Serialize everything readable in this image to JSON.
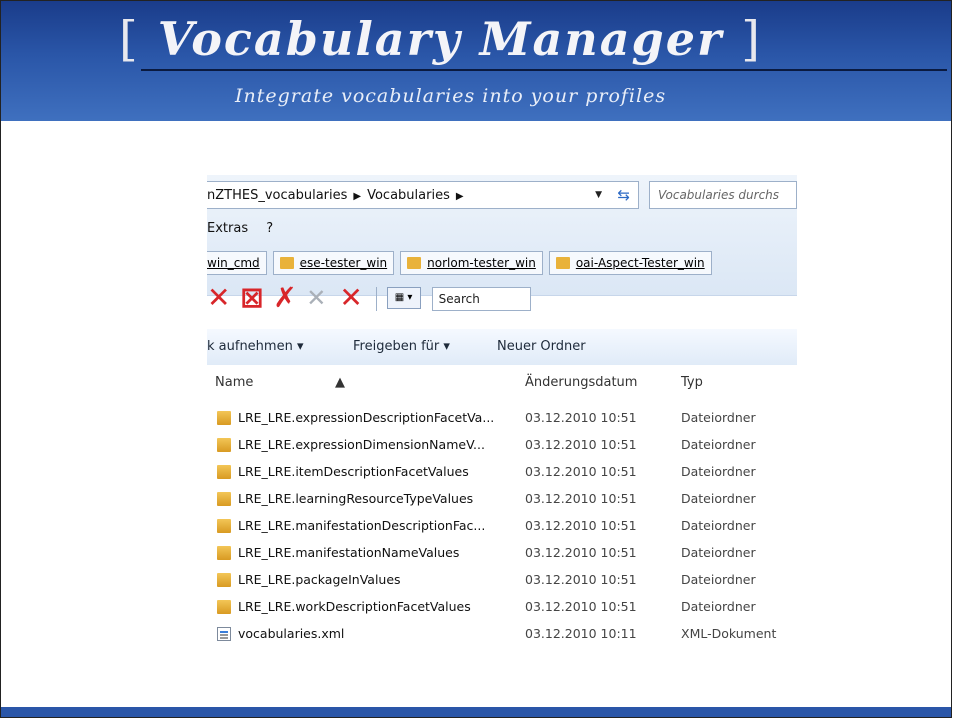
{
  "slide": {
    "title_open": "[",
    "title": "Vocabulary Manager",
    "title_close": "]",
    "subtitle": "Integrate vocabularies into your profiles"
  },
  "explorer": {
    "address": {
      "crumb1": "nZTHES_vocabularies",
      "crumb2": "Vocabularies"
    },
    "search_placeholder": "Vocabularies durchs",
    "menu": [
      "Extras",
      "?"
    ],
    "favorites": [
      "win_cmd",
      "ese-tester_win",
      "norlom-tester_win",
      "oai-Aspect-Tester_win"
    ],
    "toolbar_search": "Search",
    "commands": {
      "add": "k aufnehmen ▾",
      "share": "Freigeben für ▾",
      "new_folder": "Neuer Ordner"
    },
    "columns": {
      "name": "Name",
      "date": "Änderungsdatum",
      "type": "Typ"
    },
    "files": [
      {
        "name": "LRE_LRE.expressionDescriptionFacetVa...",
        "date": "03.12.2010 10:51",
        "type": "Dateiordner",
        "icon": "folder-icon"
      },
      {
        "name": "LRE_LRE.expressionDimensionNameV...",
        "date": "03.12.2010 10:51",
        "type": "Dateiordner",
        "icon": "folder-icon"
      },
      {
        "name": "LRE_LRE.itemDescriptionFacetValues",
        "date": "03.12.2010 10:51",
        "type": "Dateiordner",
        "icon": "folder-icon"
      },
      {
        "name": "LRE_LRE.learningResourceTypeValues",
        "date": "03.12.2010 10:51",
        "type": "Dateiordner",
        "icon": "folder-icon"
      },
      {
        "name": "LRE_LRE.manifestationDescriptionFac...",
        "date": "03.12.2010 10:51",
        "type": "Dateiordner",
        "icon": "folder-icon"
      },
      {
        "name": "LRE_LRE.manifestationNameValues",
        "date": "03.12.2010 10:51",
        "type": "Dateiordner",
        "icon": "folder-icon"
      },
      {
        "name": "LRE_LRE.packageInValues",
        "date": "03.12.2010 10:51",
        "type": "Dateiordner",
        "icon": "folder-icon"
      },
      {
        "name": "LRE_LRE.workDescriptionFacetValues",
        "date": "03.12.2010 10:51",
        "type": "Dateiordner",
        "icon": "folder-icon"
      },
      {
        "name": "vocabularies.xml",
        "date": "03.12.2010 10:11",
        "type": "XML-Dokument",
        "icon": "xml-file-icon"
      }
    ]
  },
  "colors": {
    "banner": "#2a56a8",
    "folder": "#e9b23a",
    "delete_red": "#d8262a"
  }
}
